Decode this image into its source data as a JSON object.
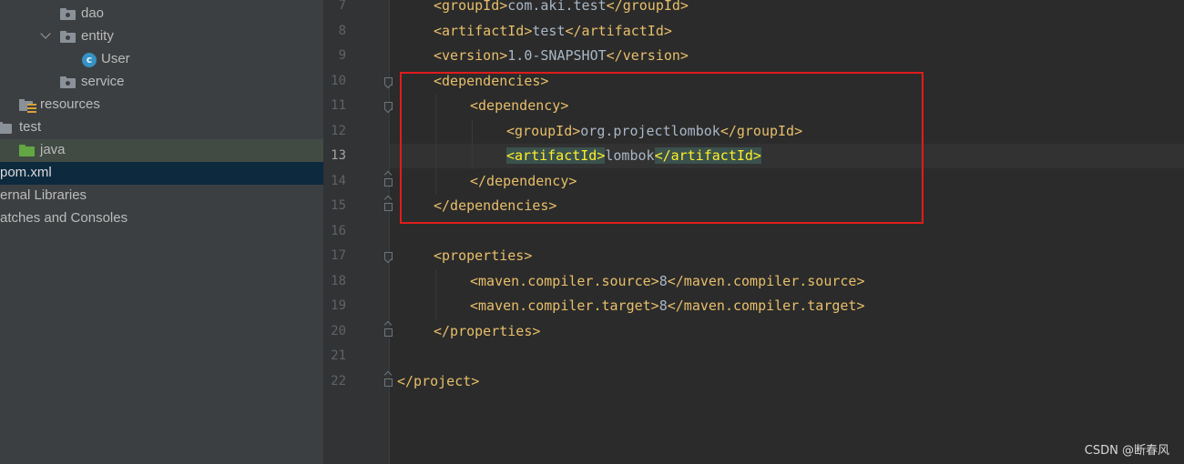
{
  "project_tree": [
    {
      "label": "dao",
      "icon": "package-folder-icon",
      "expanded": null,
      "state": "normal"
    },
    {
      "label": "entity",
      "icon": "package-folder-icon",
      "expanded": true,
      "state": "normal"
    },
    {
      "label": "User",
      "icon": "java-class-icon",
      "expanded": null,
      "state": "normal"
    },
    {
      "label": "service",
      "icon": "package-folder-icon",
      "expanded": null,
      "state": "normal"
    },
    {
      "label": "resources",
      "icon": "resources-folder-icon",
      "expanded": null,
      "state": "normal"
    },
    {
      "label": "test",
      "icon": "folder-icon",
      "expanded": null,
      "state": "normal"
    },
    {
      "label": "java",
      "icon": "test-source-folder-icon",
      "expanded": null,
      "state": "hover"
    },
    {
      "label": "pom.xml",
      "icon": "xml-file-icon",
      "expanded": null,
      "state": "selected"
    },
    {
      "label": "ernal Libraries",
      "icon": "library-icon",
      "expanded": null,
      "state": "normal"
    },
    {
      "label": "atches and Consoles",
      "icon": "scratches-icon",
      "expanded": null,
      "state": "normal"
    }
  ],
  "editor": {
    "current_line": "13",
    "lines": [
      {
        "n": "7",
        "open": "<groupId>",
        "text": "com.aki.test",
        "close": "</groupId>"
      },
      {
        "n": "8",
        "open": "<artifactId>",
        "text": "test",
        "close": "</artifactId>"
      },
      {
        "n": "9",
        "open": "<version>",
        "text": "1.0-SNAPSHOT",
        "close": "</version>"
      },
      {
        "n": "10",
        "open": "<dependencies>",
        "text": "",
        "close": ""
      },
      {
        "n": "11",
        "open": "<dependency>",
        "text": "",
        "close": ""
      },
      {
        "n": "12",
        "open": "<groupId>",
        "text": "org.projectlombok",
        "close": "</groupId>"
      },
      {
        "n": "13",
        "open": "<artifactId>",
        "text": "lombok",
        "close": "</artifactId>"
      },
      {
        "n": "14",
        "open": "</dependency>",
        "text": "",
        "close": ""
      },
      {
        "n": "15",
        "open": "</dependencies>",
        "text": "",
        "close": ""
      },
      {
        "n": "16",
        "open": "",
        "text": "",
        "close": ""
      },
      {
        "n": "17",
        "open": "<properties>",
        "text": "",
        "close": ""
      },
      {
        "n": "18",
        "open": "<maven.compiler.source>",
        "text": "8",
        "close": "</maven.compiler.source>"
      },
      {
        "n": "19",
        "open": "<maven.compiler.target>",
        "text": "8",
        "close": "</maven.compiler.target>"
      },
      {
        "n": "20",
        "open": "</properties>",
        "text": "",
        "close": ""
      },
      {
        "n": "21",
        "open": "",
        "text": "",
        "close": ""
      },
      {
        "n": "22",
        "open": "</project>",
        "text": "",
        "close": ""
      }
    ]
  },
  "colors": {
    "tag": "#e8bf6a",
    "text": "#a9b7c6",
    "annotation_box": "#e01c1c",
    "selection": "#0d293e"
  },
  "watermark": "CSDN @断春风"
}
